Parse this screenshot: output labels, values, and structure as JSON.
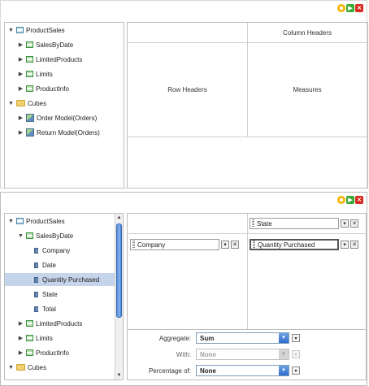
{
  "panel1": {
    "tree": [
      {
        "label": "ProductSales",
        "arrow": "▼",
        "icon": "table"
      },
      {
        "label": "SalesByDate",
        "arrow": "▶",
        "icon": "green"
      },
      {
        "label": "LimitedProducts",
        "arrow": "▶",
        "icon": "green"
      },
      {
        "label": "Limits",
        "arrow": "▶",
        "icon": "green"
      },
      {
        "label": "ProductInfo",
        "arrow": "▶",
        "icon": "green"
      },
      {
        "label": "Cubes",
        "arrow": "▼",
        "icon": "folder"
      },
      {
        "label": "Order Model(Orders)",
        "arrow": "▶",
        "icon": "cube"
      },
      {
        "label": "Return Model(Orders)",
        "arrow": "▶",
        "icon": "cube"
      }
    ],
    "grid": {
      "column_headers": "Column Headers",
      "row_headers": "Row Headers",
      "measures": "Measures"
    }
  },
  "panel2": {
    "tree": [
      {
        "label": "ProductSales",
        "arrow": "▼",
        "icon": "table"
      },
      {
        "label": "SalesByDate",
        "arrow": "▼",
        "icon": "green"
      },
      {
        "label": "Company",
        "arrow": "",
        "icon": "col"
      },
      {
        "label": "Date",
        "arrow": "",
        "icon": "col"
      },
      {
        "label": "Quantity Purchased",
        "arrow": "",
        "icon": "col",
        "selected": true
      },
      {
        "label": "State",
        "arrow": "",
        "icon": "col"
      },
      {
        "label": "Total",
        "arrow": "",
        "icon": "col"
      },
      {
        "label": "LimitedProducts",
        "arrow": "▶",
        "icon": "green"
      },
      {
        "label": "Limits",
        "arrow": "▶",
        "icon": "green"
      },
      {
        "label": "ProductInfo",
        "arrow": "▶",
        "icon": "green"
      },
      {
        "label": "Cubes",
        "arrow": "▼",
        "icon": "folder"
      }
    ],
    "column_field": "State",
    "row_field": "Company",
    "measure_field": "Quantity Purchased",
    "form": {
      "aggregate_label": "Aggregate:",
      "aggregate_value": "Sum",
      "with_label": "With:",
      "with_value": "None",
      "percentage_label": "Percentage of:",
      "percentage_value": "None"
    }
  }
}
